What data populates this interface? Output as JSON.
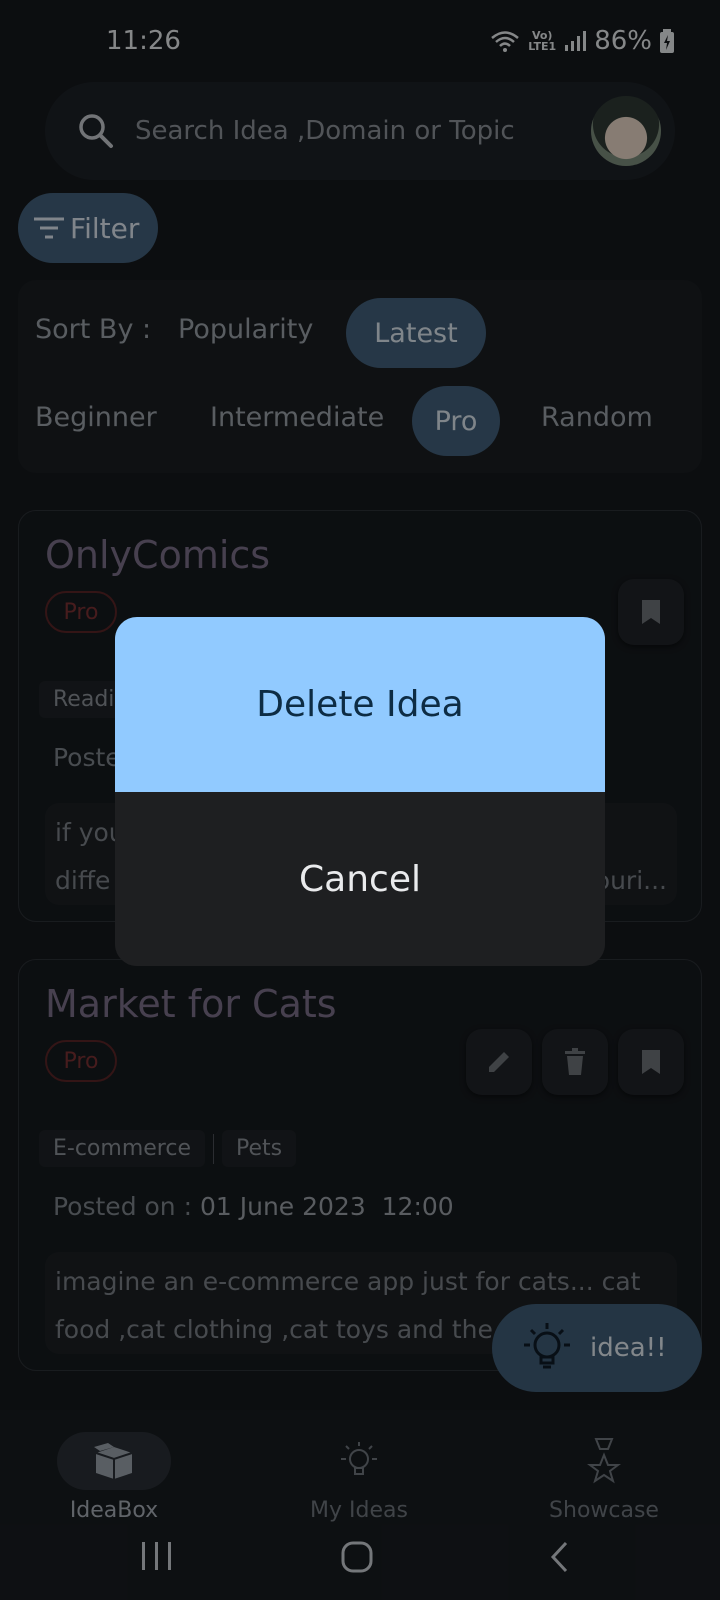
{
  "status_bar": {
    "time": "11:26",
    "network_label": "Vo) LTE1",
    "battery": "86%"
  },
  "search": {
    "placeholder": "Search Idea ,Domain or Topic"
  },
  "filter": {
    "label": "Filter"
  },
  "sort_panel": {
    "sort_label": "Sort By :",
    "sort_options": [
      "Popularity",
      "Latest"
    ],
    "selected_sort": "Latest",
    "level_options": [
      "Beginner",
      "Intermediate",
      "Pro",
      "Random"
    ],
    "selected_level": "Pro"
  },
  "cards": [
    {
      "title": "OnlyComics",
      "badge": "Pro",
      "tags": [
        "Readi"
      ],
      "posted_prefix": "Poste",
      "description_line1": "if you",
      "description_line2": "diffe",
      "description_tail": "ouri..."
    },
    {
      "title": "Market for Cats",
      "badge": "Pro",
      "tags": [
        "E-commerce",
        "Pets"
      ],
      "posted_prefix": "Posted on : ",
      "posted_date": "01 June 2023",
      "posted_time": "12:00",
      "description_line1": "imagine an e-commerce app just for cats... cat",
      "description_line2": "food ,cat clothing ,cat toys and the"
    }
  ],
  "fab": {
    "label": "idea!!"
  },
  "bottom_nav": {
    "items": [
      {
        "label": "IdeaBox",
        "icon": "box-icon",
        "active": true
      },
      {
        "label": "My Ideas",
        "icon": "lightbulb-icon",
        "active": false
      },
      {
        "label": "Showcase",
        "icon": "trophy-icon",
        "active": false
      }
    ]
  },
  "dialog": {
    "delete_label": "Delete Idea",
    "cancel_label": "Cancel"
  },
  "colors": {
    "accent": "#42607a",
    "dialog_primary": "#91caff",
    "pro_badge": "#7a3133"
  }
}
